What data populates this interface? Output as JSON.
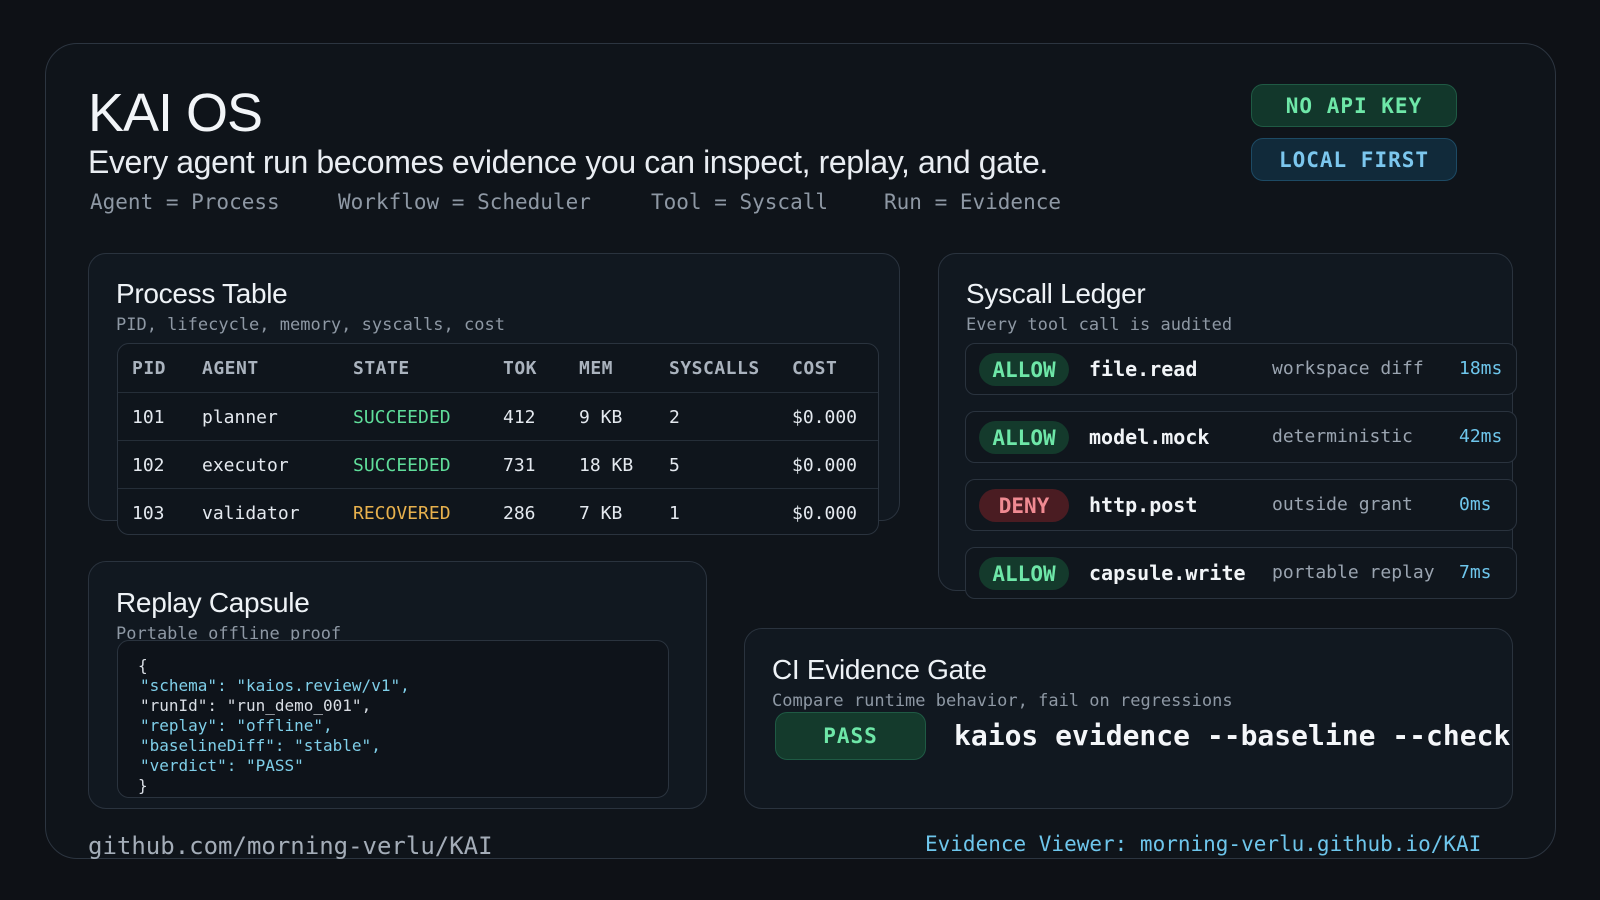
{
  "header": {
    "title": "KAI OS",
    "subtitle": "Every agent run becomes evidence you can inspect, replay, and gate.",
    "mappings": [
      "Agent = Process",
      "Workflow = Scheduler",
      "Tool = Syscall",
      "Run = Evidence"
    ]
  },
  "badges": {
    "no_api_key": "NO API KEY",
    "local_first": "LOCAL FIRST"
  },
  "process_table": {
    "title": "Process Table",
    "subtitle": "PID, lifecycle, memory, syscalls, cost",
    "columns": [
      "PID",
      "AGENT",
      "STATE",
      "TOK",
      "MEM",
      "SYSCALLS",
      "COST"
    ],
    "rows": [
      {
        "pid": "101",
        "agent": "planner",
        "state": "SUCCEEDED",
        "tok": "412",
        "mem": "9 KB",
        "syscalls": "2",
        "cost": "$0.000"
      },
      {
        "pid": "102",
        "agent": "executor",
        "state": "SUCCEEDED",
        "tok": "731",
        "mem": "18 KB",
        "syscalls": "5",
        "cost": "$0.000"
      },
      {
        "pid": "103",
        "agent": "validator",
        "state": "RECOVERED",
        "tok": "286",
        "mem": "7 KB",
        "syscalls": "1",
        "cost": "$0.000"
      }
    ],
    "state_colors": {
      "SUCCEEDED": "#5fdd9a",
      "RECOVERED": "#e8b14d"
    }
  },
  "syscall_ledger": {
    "title": "Syscall Ledger",
    "subtitle": "Every tool call is audited",
    "entries": [
      {
        "verdict": "ALLOW",
        "name": "file.read",
        "note": "workspace diff",
        "time": "18ms"
      },
      {
        "verdict": "ALLOW",
        "name": "model.mock",
        "note": "deterministic",
        "time": "42ms"
      },
      {
        "verdict": "DENY",
        "name": "http.post",
        "note": "outside grant",
        "time": "0ms"
      },
      {
        "verdict": "ALLOW",
        "name": "capsule.write",
        "note": "portable replay",
        "time": "7ms"
      }
    ]
  },
  "replay_capsule": {
    "title": "Replay Capsule",
    "subtitle": "Portable offline proof",
    "open_brace": "{",
    "close_brace": "}",
    "lines": [
      {
        "key": "\"schema\": ",
        "value": "\"kaios.review/v1\",",
        "highlight": true
      },
      {
        "key": "\"runId\": ",
        "value": "\"run_demo_001\",",
        "highlight": false
      },
      {
        "key": "\"replay\": ",
        "value": "\"offline\",",
        "highlight": true
      },
      {
        "key": "\"baselineDiff\": ",
        "value": "\"stable\",",
        "highlight": true
      },
      {
        "key": "\"verdict\": ",
        "value": "\"PASS\"",
        "highlight": true
      }
    ]
  },
  "ci_gate": {
    "title": "CI Evidence Gate",
    "subtitle": "Compare runtime behavior, fail on regressions",
    "status": "PASS",
    "command": "kaios evidence --baseline --check"
  },
  "footer": {
    "repo": "github.com/morning-verlu/KAI",
    "viewer": "Evidence Viewer: morning-verlu.github.io/KAI"
  }
}
